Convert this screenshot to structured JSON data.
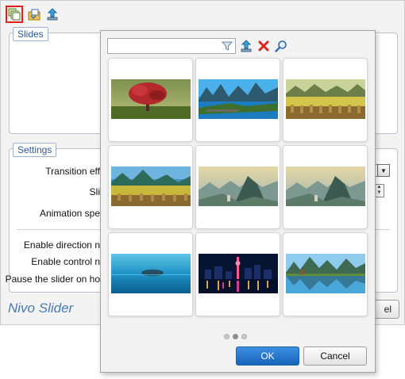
{
  "toolbar": {
    "buttons": [
      {
        "icon": "slides-icon",
        "selected": true
      },
      {
        "icon": "import-icon"
      },
      {
        "icon": "upload-icon"
      }
    ]
  },
  "slides_group": {
    "legend": "Slides"
  },
  "settings_group": {
    "legend": "Settings",
    "fields": [
      {
        "label": "Transition eff"
      },
      {
        "label": "Sli"
      },
      {
        "label": "Animation spe"
      },
      {
        "label": "Enable direction n"
      },
      {
        "label": "Enable control n"
      },
      {
        "label": "Pause the slider on ho"
      }
    ]
  },
  "footer": {
    "brand": "Nivo Slider",
    "cancel_label": "el"
  },
  "popup": {
    "search": {
      "value": "",
      "placeholder": ""
    },
    "tools": [
      "filter-icon",
      "upload-icon",
      "delete-icon",
      "search-icon"
    ],
    "thumbnails": [
      {
        "subject": "red-flowering tree on grassy field"
      },
      {
        "subject": "karst mountains over blue river"
      },
      {
        "subject": "rice fields before karst hills"
      },
      {
        "subject": "karst hills and yellow rice field"
      },
      {
        "subject": "misty karst valley with pagoda"
      },
      {
        "subject": "misty karst valley with pagoda"
      },
      {
        "subject": "island in blue sea"
      },
      {
        "subject": "city skyline at night"
      },
      {
        "subject": "karst peaks reflected in lake"
      }
    ],
    "pagination": {
      "pages": 3,
      "current": 2
    },
    "ok_label": "OK",
    "cancel_label": "Cancel"
  },
  "colors": {
    "accent": "#1a67bd",
    "brand": "#4a79b6",
    "selection": "#e0201b",
    "delete": "#d7261e"
  }
}
